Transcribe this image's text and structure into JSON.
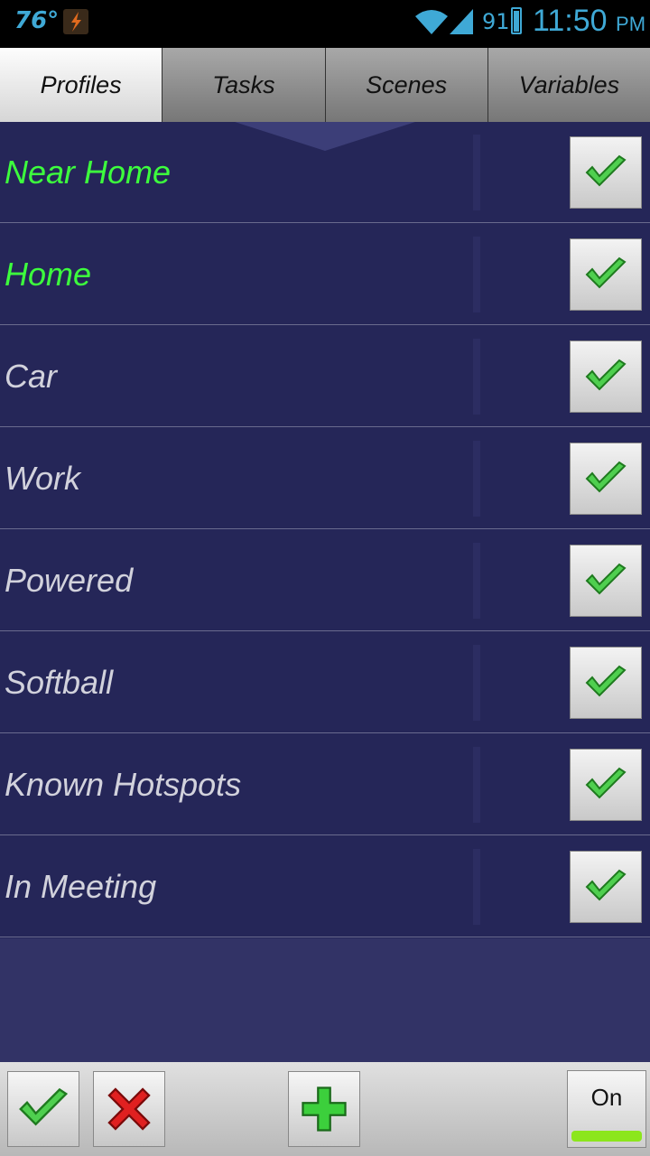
{
  "status_bar": {
    "temperature": "76°",
    "battery_percent": "91",
    "time": "11:50",
    "ampm": "PM",
    "accent_color": "#3fa9d6"
  },
  "tabs": [
    {
      "label": "Profiles",
      "active": true
    },
    {
      "label": "Tasks",
      "active": false
    },
    {
      "label": "Scenes",
      "active": false
    },
    {
      "label": "Variables",
      "active": false
    }
  ],
  "profiles": [
    {
      "name": "Near Home",
      "active": true,
      "enabled": true
    },
    {
      "name": "Home",
      "active": true,
      "enabled": true
    },
    {
      "name": "Car",
      "active": false,
      "enabled": true
    },
    {
      "name": "Work",
      "active": false,
      "enabled": true
    },
    {
      "name": "Powered",
      "active": false,
      "enabled": true
    },
    {
      "name": "Softball",
      "active": false,
      "enabled": true
    },
    {
      "name": "Known Hotspots",
      "active": false,
      "enabled": true
    },
    {
      "name": "In Meeting",
      "active": false,
      "enabled": true
    }
  ],
  "toolbar": {
    "accept_icon": "check-icon",
    "cancel_icon": "x-icon",
    "add_icon": "plus-icon",
    "toggle_label": "On",
    "toggle_color": "#8ce61c"
  },
  "colors": {
    "active_profile": "#3dff3d",
    "inactive_profile": "#d2d2dc",
    "list_background": "#252658"
  }
}
